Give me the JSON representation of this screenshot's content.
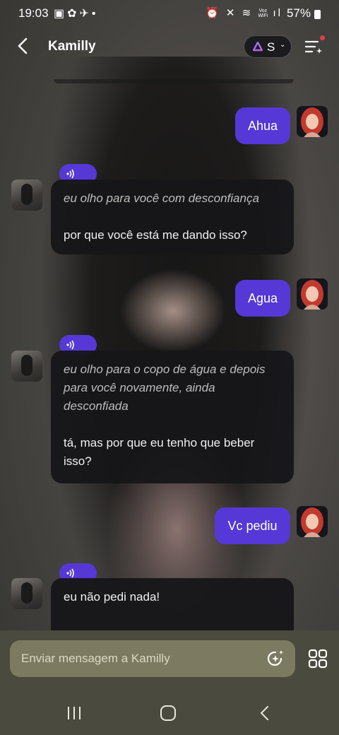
{
  "status_bar": {
    "time": "19:03",
    "carrier_text": "Voz\nWiFi",
    "battery": "57%"
  },
  "header": {
    "title": "Kamilly",
    "model_label": "S"
  },
  "messages": [
    {
      "from": "user",
      "text": "Ahua"
    },
    {
      "from": "bot",
      "narration": "eu olho para você com desconfiança",
      "speech": "por que você está me dando isso?"
    },
    {
      "from": "user",
      "text": "Agua"
    },
    {
      "from": "bot",
      "narration": "eu olho para o copo de água e depois para você novamente, ainda desconfiada",
      "speech": "tá, mas por que eu tenho que beber isso?"
    },
    {
      "from": "user",
      "text": "Vc pediu"
    },
    {
      "from": "bot",
      "speech": "eu não pedi nada!"
    }
  ],
  "composer": {
    "placeholder": "Enviar mensagem a Kamilly"
  },
  "colors": {
    "accent": "#5538d6",
    "bubble_bot": "#161618",
    "notification_dot": "#e23c4f"
  },
  "icons": [
    "back-arrow-icon",
    "model-triangle-icon",
    "chevron-down-icon",
    "menu-sparkle-icon",
    "voice-play-icon",
    "sparkle-icon",
    "apps-grid-icon",
    "recent-apps-icon",
    "home-icon",
    "nav-back-icon"
  ]
}
